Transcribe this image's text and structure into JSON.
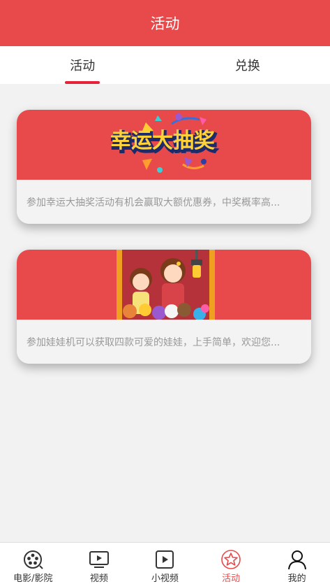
{
  "header": {
    "title": "活动"
  },
  "tabs": [
    {
      "label": "活动",
      "active": true
    },
    {
      "label": "兑换",
      "active": false
    }
  ],
  "cards": [
    {
      "banner_text": "幸运大抽奖",
      "description": "参加幸运大抽奖活动有机会赢取大额优惠券，中奖概率高..."
    },
    {
      "description": "参加娃娃机可以获取四款可爱的娃娃，上手简单，欢迎您..."
    }
  ],
  "nav": [
    {
      "label": "电影/影院",
      "icon": "film-reel-icon"
    },
    {
      "label": "视频",
      "icon": "tv-play-icon"
    },
    {
      "label": "小视频",
      "icon": "play-square-icon"
    },
    {
      "label": "活动",
      "icon": "star-circle-icon",
      "active": true
    },
    {
      "label": "我的",
      "icon": "person-icon"
    }
  ],
  "colors": {
    "brand": "#e84a4b",
    "tab_underline": "#e8203a"
  }
}
